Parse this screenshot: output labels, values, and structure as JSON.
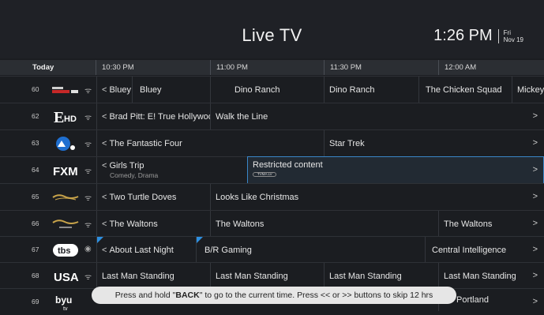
{
  "header": {
    "title": "Live TV",
    "time": "1:26 PM",
    "day": "Fri",
    "date": "Nov 19"
  },
  "timebar": {
    "today": "Today",
    "slots": [
      "10:30 PM",
      "11:00 PM",
      "11:30 PM",
      "12:00 AM"
    ]
  },
  "rows": [
    {
      "num": "60",
      "logo": "Disney Junior",
      "programs": [
        "Bluey",
        "Bluey",
        "Dino Ranch",
        "Dino Ranch",
        "The Chicken Squad",
        "Mickey"
      ]
    },
    {
      "num": "62",
      "logo": "E! HD",
      "programs": [
        "Brad Pitt: E! True Hollywood",
        "Walk the Line"
      ]
    },
    {
      "num": "63",
      "logo": "Paramount Network",
      "programs": [
        "The Fantastic Four",
        "Star Trek"
      ]
    },
    {
      "num": "64",
      "logo": "FXM",
      "programs": [
        "Girls Trip",
        "Restricted content"
      ],
      "sub": "Comedy, Drama",
      "badge": "TVMA LV"
    },
    {
      "num": "65",
      "logo": "Hallmark",
      "programs": [
        "Two Turtle Doves",
        "Looks Like Christmas"
      ]
    },
    {
      "num": "66",
      "logo": "Hallmark Drama",
      "programs": [
        "The Waltons",
        "The Waltons",
        "The Waltons"
      ]
    },
    {
      "num": "67",
      "logo": "tbs",
      "programs": [
        "About Last Night",
        "B/R Gaming",
        "Central Intelligence"
      ]
    },
    {
      "num": "68",
      "logo": "USA",
      "programs": [
        "Last Man Standing",
        "Last Man Standing",
        "Last Man Standing",
        "Last Man Standing"
      ]
    },
    {
      "num": "69",
      "logo": "BYU tv",
      "programs": [
        "Portland"
      ]
    }
  ],
  "toast": {
    "pre": "Press and hold \"",
    "key": "BACK",
    "post": "\" to go to the current time. Press << or >> buttons to skip 12 hrs"
  },
  "colors": {
    "accent": "#3a86c8",
    "background": "#1b1d21"
  }
}
